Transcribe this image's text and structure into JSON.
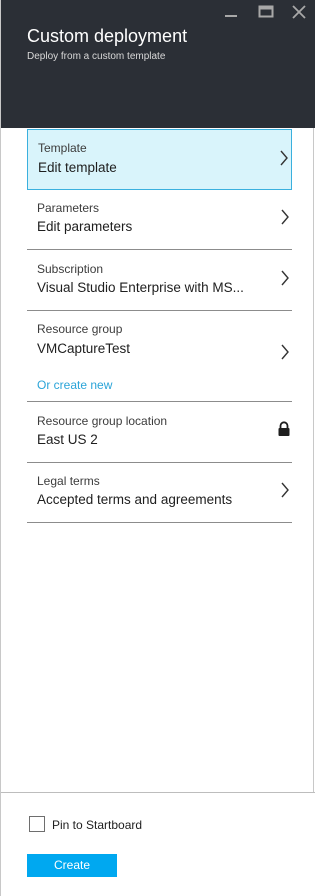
{
  "header": {
    "title": "Custom deployment",
    "subtitle": "Deploy from a custom template",
    "controls": [
      "minimize-icon",
      "maximize-icon",
      "close-icon"
    ]
  },
  "items": [
    {
      "label": "Template",
      "value": "Edit template",
      "selected": true,
      "icon": "chevron-right-icon"
    },
    {
      "label": "Parameters",
      "value": "Edit parameters",
      "icon": "chevron-right-icon"
    },
    {
      "label": "Subscription",
      "value": "Visual Studio Enterprise with MS...",
      "icon": "chevron-right-icon"
    },
    {
      "label": "Resource group",
      "value": "VMCaptureTest",
      "link": "Or create new",
      "icon": "chevron-right-icon"
    },
    {
      "label": "Resource group location",
      "value": "East US 2",
      "icon": "lock-icon"
    },
    {
      "label": "Legal terms",
      "value": "Accepted terms and agreements",
      "icon": "chevron-right-icon"
    }
  ],
  "footer": {
    "pin_label": "Pin to Startboard",
    "pin_checked": false,
    "create_label": "Create"
  },
  "colors": {
    "header_bg": "#2b2f36",
    "selected_bg": "#d9f4fb",
    "selected_border": "#3ab0de",
    "link": "#2aa4d8",
    "button": "#00a8f0"
  }
}
